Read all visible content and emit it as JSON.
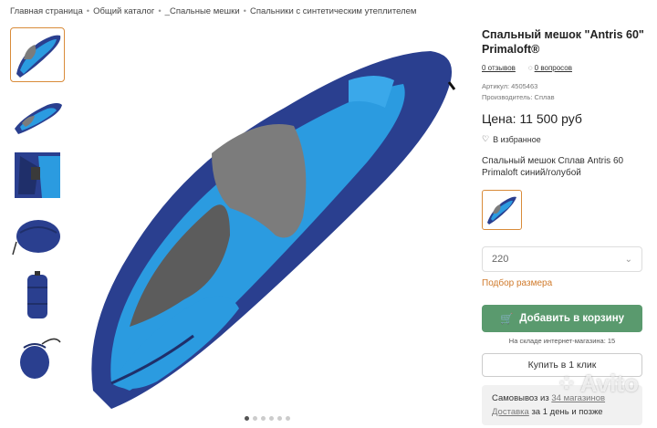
{
  "breadcrumb": [
    "Главная страница",
    "Общий каталог",
    "_Спальные мешки",
    "Спальники с синтетическим утеплителем"
  ],
  "product": {
    "title": "Спальный мешок \"Antris 60\" Primaloft®",
    "reviews": "0 отзывов",
    "questions": "0 вопросов",
    "sku": "Артикул: 4505463",
    "manufacturer": "Производитель: Сплав",
    "price": "Цена: 11 500 руб",
    "favorite": "В избранное",
    "variant_desc": "Спальный мешок Сплав Antris 60 Primaloft синий/голубой",
    "size_value": "220",
    "size_guide": "Подбор размера",
    "add_to_cart": "Добавить в корзину",
    "stock": "На складе интернет-магазина: 15",
    "buy_one_click": "Купить в 1 клик",
    "pickup_prefix": "Самовывоз из ",
    "pickup_link": "34 магазинов",
    "delivery_link": "Доставка",
    "delivery_suffix": " за 1 день и позже"
  },
  "watermark": "Avito",
  "colors": {
    "accent": "#5a9a6e",
    "link_orange": "#d07a2b",
    "bag_navy": "#2a3f8f",
    "bag_blue": "#2b9be0",
    "bag_gray": "#7c7c7c"
  },
  "icons": {
    "cart": "cart-icon",
    "heart": "heart-icon",
    "comment": "comment-icon",
    "chevron": "chevron-down-icon"
  }
}
